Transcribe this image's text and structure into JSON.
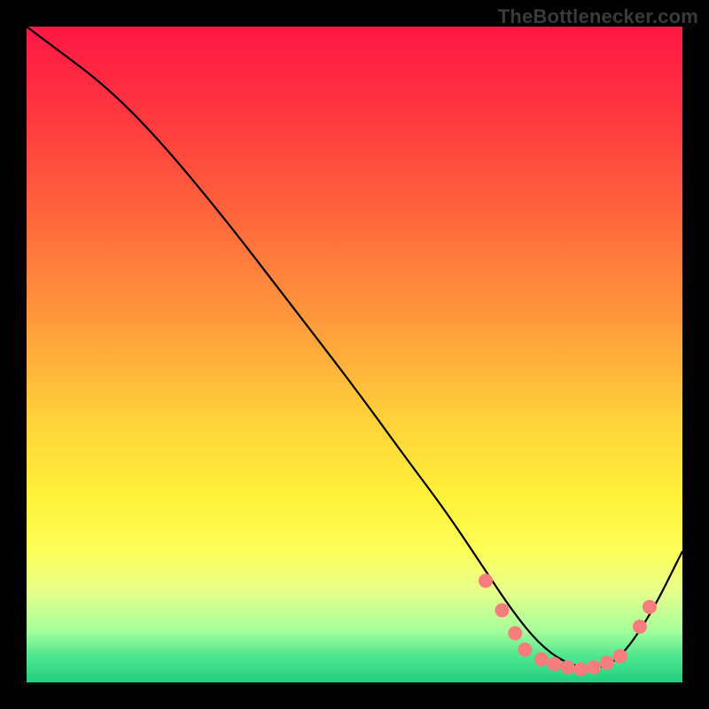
{
  "watermark": "TheBottlenecker.com",
  "chart_data": {
    "type": "line",
    "title": "",
    "xlabel": "",
    "ylabel": "",
    "xlim": [
      0,
      100
    ],
    "ylim": [
      0,
      100
    ],
    "grid": false,
    "background": {
      "stops": [
        {
          "offset": 0.0,
          "color": "#ff1744"
        },
        {
          "offset": 0.15,
          "color": "#ff3b3f"
        },
        {
          "offset": 0.3,
          "color": "#ff6a3c"
        },
        {
          "offset": 0.45,
          "color": "#ff9a3c"
        },
        {
          "offset": 0.6,
          "color": "#ffd23a"
        },
        {
          "offset": 0.72,
          "color": "#fff23a"
        },
        {
          "offset": 0.8,
          "color": "#fdff59"
        },
        {
          "offset": 0.86,
          "color": "#e7ff8a"
        },
        {
          "offset": 0.92,
          "color": "#a8ff9a"
        },
        {
          "offset": 0.96,
          "color": "#4fe68f"
        },
        {
          "offset": 1.0,
          "color": "#1fcf7f"
        }
      ]
    },
    "series": [
      {
        "name": "bottleneck-curve",
        "x": [
          0,
          4,
          12,
          20,
          30,
          40,
          50,
          58,
          64,
          70,
          74,
          78,
          82,
          86,
          90,
          95,
          100
        ],
        "y": [
          100,
          97,
          91,
          83,
          71,
          58,
          45,
          34,
          26,
          17,
          11,
          6,
          3,
          2,
          3,
          10,
          20
        ]
      }
    ],
    "markers": {
      "name": "highlight-points",
      "color": "#f77d7d",
      "radius": 8,
      "points": [
        {
          "x": 70.0,
          "y": 15.5
        },
        {
          "x": 72.5,
          "y": 11.0
        },
        {
          "x": 74.5,
          "y": 7.5
        },
        {
          "x": 76.0,
          "y": 5.0
        },
        {
          "x": 78.5,
          "y": 3.5
        },
        {
          "x": 80.5,
          "y": 2.8
        },
        {
          "x": 82.5,
          "y": 2.3
        },
        {
          "x": 84.5,
          "y": 2.0
        },
        {
          "x": 86.5,
          "y": 2.3
        },
        {
          "x": 88.5,
          "y": 3.0
        },
        {
          "x": 90.5,
          "y": 4.0
        },
        {
          "x": 93.5,
          "y": 8.5
        },
        {
          "x": 95.0,
          "y": 11.5
        }
      ]
    }
  }
}
